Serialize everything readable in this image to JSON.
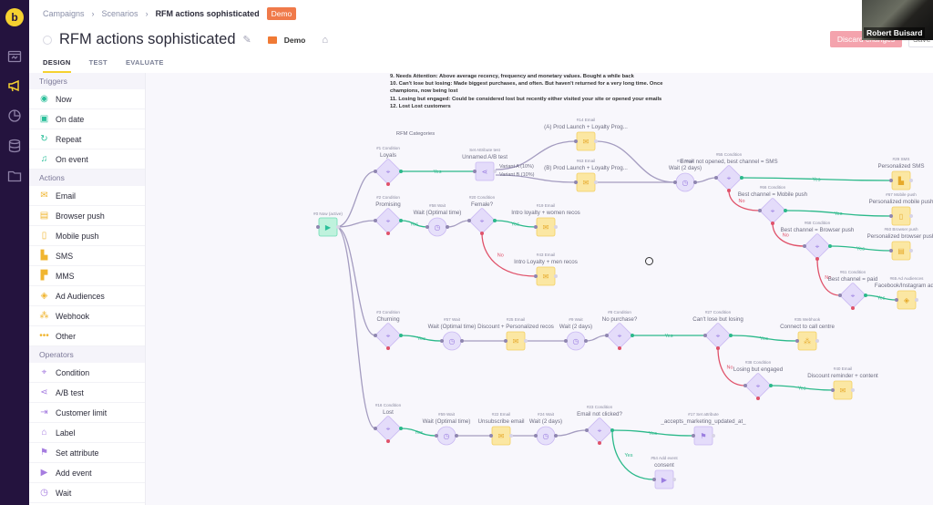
{
  "app": {
    "logo": "b"
  },
  "rail": {
    "icons": [
      "dashboard-icon",
      "megaphone-icon",
      "analytics-icon",
      "database-icon",
      "folder-icon"
    ]
  },
  "breadcrumb": {
    "items": [
      "Campaigns",
      "Scenarios",
      "RFM actions sophisticated"
    ],
    "badge": "Demo"
  },
  "scenario": {
    "title": "RFM actions sophisticated",
    "folder": "Demo"
  },
  "tabs": [
    {
      "label": "DESIGN",
      "active": true
    },
    {
      "label": "TEST",
      "active": false
    },
    {
      "label": "EVALUATE",
      "active": false
    }
  ],
  "buttons": {
    "discard": "Discard changes",
    "save": "Save"
  },
  "video": {
    "name": "Robert Buisard"
  },
  "palette": {
    "sections": [
      {
        "title": "Triggers",
        "items": [
          {
            "label": "Now",
            "icon": "play-icon",
            "glyph": "◉"
          },
          {
            "label": "On date",
            "icon": "calendar-icon",
            "glyph": "▣"
          },
          {
            "label": "Repeat",
            "icon": "repeat-icon",
            "glyph": "↻"
          },
          {
            "label": "On event",
            "icon": "bell-icon",
            "glyph": "♫"
          }
        ]
      },
      {
        "title": "Actions",
        "items": [
          {
            "label": "Email",
            "icon": "email-icon",
            "glyph": "✉"
          },
          {
            "label": "Browser push",
            "icon": "browser-push-icon",
            "glyph": "▤"
          },
          {
            "label": "Mobile push",
            "icon": "mobile-push-icon",
            "glyph": "▯"
          },
          {
            "label": "SMS",
            "icon": "sms-icon",
            "glyph": "▙"
          },
          {
            "label": "MMS",
            "icon": "mms-icon",
            "glyph": "▛"
          },
          {
            "label": "Ad Audiences",
            "icon": "target-icon",
            "glyph": "◈"
          },
          {
            "label": "Webhook",
            "icon": "webhook-icon",
            "glyph": "⁂"
          },
          {
            "label": "Other",
            "icon": "more-icon",
            "glyph": "•••"
          }
        ]
      },
      {
        "title": "Operators",
        "items": [
          {
            "label": "Condition",
            "icon": "condition-icon",
            "glyph": "⌖"
          },
          {
            "label": "A/B test",
            "icon": "ab-test-icon",
            "glyph": "⋖"
          },
          {
            "label": "Customer limit",
            "icon": "limit-icon",
            "glyph": "⇥"
          },
          {
            "label": "Label",
            "icon": "tag-icon",
            "glyph": "⌂"
          },
          {
            "label": "Set attribute",
            "icon": "set-attribute-icon",
            "glyph": "⚑"
          },
          {
            "label": "Add event",
            "icon": "add-event-icon",
            "glyph": "▶"
          },
          {
            "label": "Wait",
            "icon": "clock-icon",
            "glyph": "◷"
          }
        ]
      }
    ]
  },
  "notes": [
    "9. Needs Attention: Above average recency, frequency and monetary values. Bought a while back",
    "10. Can't lose but losing: Made biggest purchases, and often. But haven't returned for a very long time. Once champions, now being lost",
    "11. Losing but engaged: Could be considered lost but recently either visited your site or opened your emails",
    "12. Lost Lost customers"
  ],
  "flow": {
    "group_label": "RFM Categories",
    "nodes": [
      {
        "id": "n0",
        "kind": "trigger",
        "num": "#0 Now (active)",
        "title": ""
      },
      {
        "id": "n1",
        "kind": "condition",
        "num": "#1 Condition",
        "title": "Loyals"
      },
      {
        "id": "n2",
        "kind": "condition",
        "num": "#2 Condition",
        "title": "Promising"
      },
      {
        "id": "n3",
        "kind": "condition",
        "num": "#3 Condition",
        "title": "Churning"
      },
      {
        "id": "n16",
        "kind": "condition",
        "num": "#16 Condition",
        "title": "Lost"
      },
      {
        "id": "nab",
        "kind": "abtest",
        "num": "Set Attribute test",
        "title": "Unnamed A/B test"
      },
      {
        "id": "n14",
        "kind": "email",
        "num": "#14 Email",
        "title": "(A) Prod Launch + Loyalty Prog..."
      },
      {
        "id": "n63",
        "kind": "email",
        "num": "#63 Email",
        "title": "(B) Prod Launch + Loyalty Prog..."
      },
      {
        "id": "n31",
        "kind": "wait",
        "num": "#31 Wait",
        "title": "Wait (2 days)"
      },
      {
        "id": "n55",
        "kind": "condition",
        "num": "#55 Condition",
        "title": "Email not opened, best channel = SMS"
      },
      {
        "id": "n66",
        "kind": "condition",
        "num": "#66 Condition",
        "title": "Best channel = Mobile push"
      },
      {
        "id": "n68",
        "kind": "condition",
        "num": "#68 Condition",
        "title": "Best channel = Browser push"
      },
      {
        "id": "n61",
        "kind": "condition",
        "num": "#61 Condition",
        "title": "Best channel = paid"
      },
      {
        "id": "n29",
        "kind": "sms",
        "num": "#29 SMS",
        "title": "Personalized SMS"
      },
      {
        "id": "n67",
        "kind": "mobile",
        "num": "#67 Mobile push",
        "title": "Personalized mobile push"
      },
      {
        "id": "n60",
        "kind": "browser",
        "num": "#60 Browser push",
        "title": "Personalized browser push"
      },
      {
        "id": "n65",
        "kind": "ads",
        "num": "#65 Ad Audiences",
        "title": "Facebook/Instagram ad..."
      },
      {
        "id": "n58",
        "kind": "wait",
        "num": "#58 Wait",
        "title": "Wait (Optimal time)"
      },
      {
        "id": "n20",
        "kind": "condition",
        "num": "#20 Condition",
        "title": "Female?"
      },
      {
        "id": "n19",
        "kind": "email",
        "num": "#19 Email",
        "title": "Intro loyalty + women recos"
      },
      {
        "id": "n43",
        "kind": "email",
        "num": "#43 Email",
        "title": "Intro Loyalty + men recos"
      },
      {
        "id": "n57",
        "kind": "wait",
        "num": "#57 Wait",
        "title": "Wait (Optimal time)"
      },
      {
        "id": "n25",
        "kind": "email",
        "num": "#25 Email",
        "title": "Discount + Personalized recos"
      },
      {
        "id": "n9",
        "kind": "wait",
        "num": "#9 Wait",
        "title": "Wait (2 days)"
      },
      {
        "id": "n8",
        "kind": "condition",
        "num": "#8 Condition",
        "title": "No purchase?"
      },
      {
        "id": "n27",
        "kind": "condition",
        "num": "#27 Condition",
        "title": "Can't lose but losing"
      },
      {
        "id": "n35",
        "kind": "webhook",
        "num": "#35 Webhook",
        "title": "Connect to call centre"
      },
      {
        "id": "n38",
        "kind": "condition",
        "num": "#38 Condition",
        "title": "Losing but engaged"
      },
      {
        "id": "n40",
        "kind": "email",
        "num": "#40 Email",
        "title": "Discount reminder + content"
      },
      {
        "id": "n59",
        "kind": "wait",
        "num": "#59 Wait",
        "title": "Wait (Optimal time)"
      },
      {
        "id": "n22",
        "kind": "email",
        "num": "#22 Email",
        "title": "Unsubscribe email"
      },
      {
        "id": "n24",
        "kind": "wait",
        "num": "#24 Wait",
        "title": "Wait (2 days)"
      },
      {
        "id": "n23",
        "kind": "condition",
        "num": "#23 Condition",
        "title": "Email not clicked?"
      },
      {
        "id": "n17",
        "kind": "setattr",
        "num": "#17 Set attribute",
        "title": "_accepts_marketing_updated_at_"
      },
      {
        "id": "n54",
        "kind": "addevent",
        "num": "#54 Add event",
        "title": "consent"
      }
    ],
    "branch_labels": {
      "yes": "Yes",
      "no": "No"
    },
    "ab_variants": [
      "Variant A (10%)",
      "Variant B (10%)"
    ]
  },
  "colors": {
    "accent": "#f5d130",
    "rail": "#24133e",
    "yes": "#2bb98a",
    "no": "#e0526a",
    "condition": "#e4dcfa",
    "email": "#fbe7a3",
    "trigger": "#bff2dd"
  }
}
